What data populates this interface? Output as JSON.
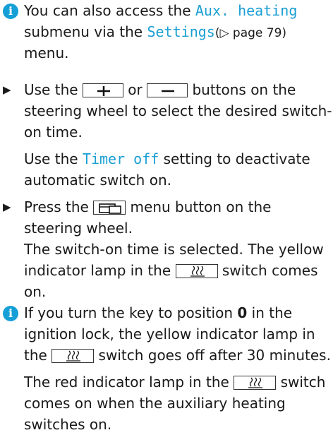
{
  "note1": {
    "icon": "info-icon",
    "t1": "You can also access the ",
    "aux_heating": "Aux. heating",
    "t2": "submenu via the ",
    "settings": "Settings",
    "page_ref": "(▷ page 79)",
    "t3": "menu."
  },
  "step1": {
    "t1": "Use the ",
    "plus_icon": "plus-icon",
    "or": " or ",
    "minus_icon": "minus-icon",
    "t2": " buttons on the",
    "t3": "steering wheel to select the desired switch-",
    "t4": "on time.",
    "t5": "Use the ",
    "timer_off": "Timer off",
    "t6": " setting to deactivate",
    "t7": "automatic switch on."
  },
  "step2": {
    "t1": "Press the ",
    "menu_icon": "menu-button-icon",
    "t2": " menu button on the",
    "t3": "steering wheel.",
    "t4": "The switch-on time is selected. The yellow",
    "t5": "indicator lamp in the ",
    "heater_icon": "heater-icon",
    "t6": " switch comes",
    "t7": "on."
  },
  "note2": {
    "t1": "If you turn the key to position ",
    "pos": "0",
    "t2": " in the",
    "t3": "ignition lock, the yellow indicator lamp in",
    "t4": "the ",
    "t5": " switch goes off after 30 minutes.",
    "t6": "The red indicator lamp in the ",
    "t7": " switch",
    "t8": "comes on when the auxiliary heating",
    "t9": "switches on."
  }
}
